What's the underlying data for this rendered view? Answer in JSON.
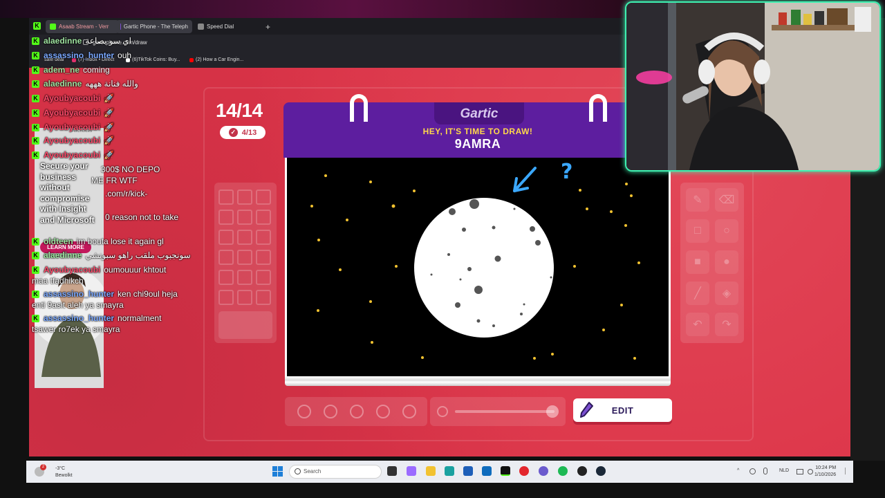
{
  "browser": {
    "tabs": [
      {
        "label": "Asaab Stream - Verr"
      },
      {
        "label": "Gartic Phone - The Teleph"
      },
      {
        "label": "Speed Dial"
      }
    ],
    "new_tab_icon": "+",
    "url": "garticphone.com/draw",
    "bookmarks": [
      {
        "label": "safe deal"
      },
      {
        "label": "(7) Inbox • Direct"
      },
      {
        "label": "(6)TikTok Coins: Buy..."
      },
      {
        "label": "(2) How a Car Engin..."
      }
    ]
  },
  "game": {
    "round_counter": "14/14",
    "done_count": "4/13",
    "logo": "Gartic",
    "prompt": "HEY, IT'S TIME TO DRAW!",
    "word": "9AMRA",
    "edit_label": "EDIT",
    "colors": {
      "accent_bg": "#dc3448",
      "book_purple": "#5d1e9f",
      "prompt_yellow": "#ffd84a"
    }
  },
  "chat": {
    "messages": [
      {
        "user": "alaedinne",
        "text": "اي سو بصاعة",
        "color": "#9fe3a0"
      },
      {
        "user": "assassino_hunter",
        "text": "ouh",
        "color": "#7aa8ff"
      },
      {
        "user": "adem_ne",
        "text": "coming",
        "color": "#9fe3a0"
      },
      {
        "user": "alaedinne",
        "text": "والله فنانة هههه",
        "color": "#9fe3a0"
      },
      {
        "user": "Ayoubyacoubi",
        "text": "🚀",
        "color": "#ff4a6a"
      },
      {
        "user": "Ayoubyacoubi",
        "text": "🚀",
        "color": "#ff4a6a"
      },
      {
        "user": "Ayoubyacoubi",
        "text": "🚀",
        "color": "#ff4a6a"
      },
      {
        "user": "Ayoubyacoubi",
        "text": "🚀",
        "color": "#ff4a6a"
      },
      {
        "user": "Ayoubyacoubi",
        "text": "🚀",
        "color": "#ff4a6a"
      },
      {
        "user": "",
        "text": "300$ NO DEPO",
        "color": "#fff"
      },
      {
        "user": "",
        "text": "ME FR WTF",
        "color": "#fff"
      },
      {
        "user": "",
        "text": ".com/r/kick-",
        "color": "#fff"
      },
      {
        "user": "",
        "text": "0 reason not to take",
        "color": "#fff"
      },
      {
        "user": "oldteen",
        "text": "im bouta lose it again gl",
        "color": "#9fe3a0"
      },
      {
        "user": "alaedinne",
        "text": "سونجبوب ملقب راهو سبونشي",
        "color": "#9fe3a0"
      },
      {
        "user": "Ayoubyacoubi",
        "text": "oumouuur khtout",
        "color": "#ff4a6a"
      },
      {
        "user": "",
        "text": "maa tfadhikch",
        "color": "#fff"
      },
      {
        "user": "assassino_hunter",
        "text": "ken chi9oul heja",
        "color": "#7aa8ff"
      },
      {
        "user": "",
        "text": "enti 9asit aleh ya smayra",
        "color": "#fff"
      },
      {
        "user": "assassino_hunter",
        "text": "normalment",
        "color": "#7aa8ff"
      },
      {
        "user": "",
        "text": "tsawer ro7ek ya smayra",
        "color": "#fff"
      }
    ]
  },
  "ad": {
    "label": "AdChoices",
    "headline": "Secure your business without compromise with Insight and Microsoft",
    "cta": "LEARN MORE"
  },
  "taskbar": {
    "weather_temp": "-3°C",
    "weather_desc": "Bewolkt",
    "weather_badge": "2",
    "search_placeholder": "Search",
    "lang": "NLD",
    "time": "10:24 PM",
    "date": "1/10/2026"
  }
}
